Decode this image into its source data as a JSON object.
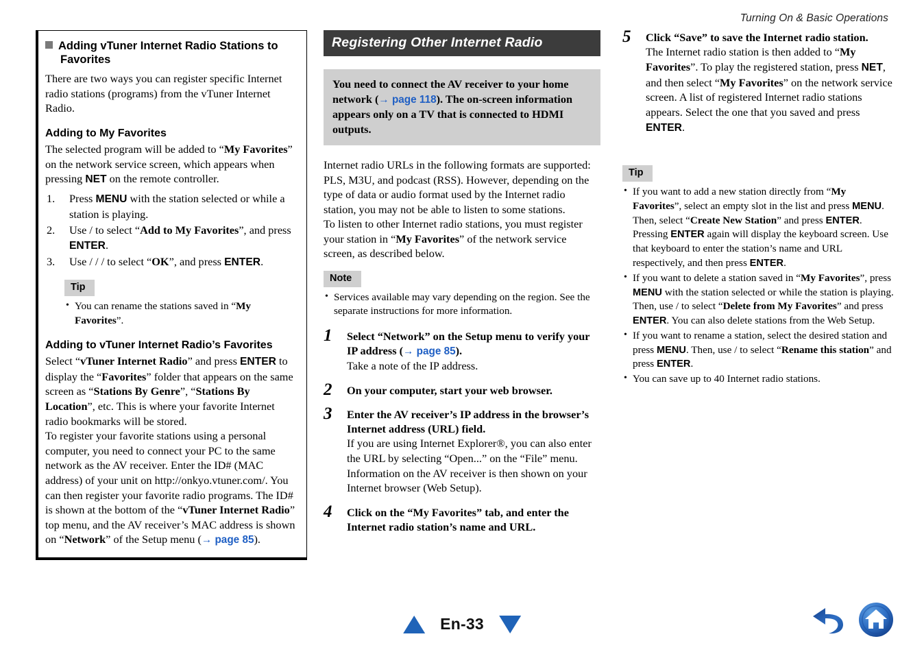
{
  "header": {
    "running_title": "Turning On & Basic Operations"
  },
  "column1": {
    "heading": "Adding vTuner Internet Radio Stations to Favorites",
    "intro": "There are two ways you can register specific Internet radio stations (programs) from the vTuner Internet Radio.",
    "sub1": {
      "heading": "Adding to My Favorites",
      "intro_a": "The selected program will be added to “",
      "intro_b": "My Favorites",
      "intro_c": "” on the network service screen, which appears when pressing ",
      "intro_d": "NET",
      "intro_e": " on the remote controller.",
      "steps": [
        {
          "number": "1.",
          "a": "Press ",
          "b": "MENU",
          "c": " with the station selected or while a station is playing."
        },
        {
          "number": "2.",
          "a": "Use   /   to select “",
          "b": "Add to My Favorites",
          "c": "”, and press ",
          "d": "ENTER",
          "e": "."
        },
        {
          "number": "3.",
          "a": "Use   /   /   /    to select “",
          "b": "OK",
          "c": "”, and press ",
          "d": "ENTER",
          "e": "."
        }
      ],
      "tip_badge": "Tip",
      "tip_a": "You can rename the stations saved in “",
      "tip_b": "My Favorites",
      "tip_c": "”."
    },
    "sub2": {
      "heading": "Adding to vTuner Internet Radio’s Favorites",
      "p1_a": "Select “",
      "p1_b": "vTuner Internet Radio",
      "p1_c": "” and press ",
      "p1_d": "ENTER",
      "p1_e": " to display the “",
      "p1_f": "Favorites",
      "p1_g": "” folder that appears on the same screen as “",
      "p1_h": "Stations By Genre",
      "p1_i": "”, “",
      "p1_j": "Stations By Location",
      "p1_k": "”, etc. This is where your favorite Internet radio bookmarks will be stored.",
      "p2_a": "To register your favorite stations using a personal computer, you need to connect your PC to the same network as the AV receiver. Enter the ID# (MAC address) of your unit on http://onkyo.vtuner.com/. You can then register your favorite radio programs. The ID# is shown at the bottom of the “",
      "p2_b": "vTuner Internet Radio",
      "p2_c": "” top menu, and the AV receiver’s MAC address is shown on “",
      "p2_d": "Network",
      "p2_e": "” of the Setup menu (",
      "p2_xref": "→ page 85",
      "p2_f": ")."
    }
  },
  "column2": {
    "banner": "Registering Other Internet Radio",
    "callout_a": "You need to connect the AV receiver to your home network (",
    "callout_xref": "→ page 118",
    "callout_b": "). The on-screen information appears only on a TV that is connected to HDMI outputs.",
    "p1": "Internet radio URLs in the following formats are supported: PLS, M3U, and podcast (RSS). However, depending on the type of data or audio format used by the Internet radio station, you may not be able to listen to some stations.",
    "p2_a": "To listen to other Internet radio stations, you must register your station in “",
    "p2_b": "My Favorites",
    "p2_c": "” of the network service screen, as described below.",
    "note_badge": "Note",
    "note_bullet": "Services available may vary depending on the region. See the separate instructions for more information.",
    "steps": [
      {
        "number": "1",
        "title_a": "Select “Network” on the Setup menu to verify your IP address (",
        "title_xref": "→ page 85",
        "title_b": ").",
        "desc": "Take a note of the IP address."
      },
      {
        "number": "2",
        "title_a": "On your computer, start your web browser.",
        "desc": ""
      },
      {
        "number": "3",
        "title_a": "Enter the AV receiver’s IP address in the browser’s Internet address (URL) field.",
        "desc": "If you are using Internet Explorer®, you can also enter the URL by selecting “Open...” on the “File” menu. Information on the AV receiver is then shown on your Internet browser (Web Setup)."
      },
      {
        "number": "4",
        "title_a": "Click on the “My Favorites” tab, and enter the Internet radio station’s name and URL.",
        "desc": ""
      }
    ]
  },
  "column3": {
    "step5": {
      "number": "5",
      "title": "Click “Save” to save the Internet radio station.",
      "d_a": "The Internet radio station is then added to “",
      "d_b": "My Favorites",
      "d_c": "”. To play the registered station, press ",
      "d_d": "NET",
      "d_e": ", and then select “",
      "d_f": "My Favorites",
      "d_g": "” on the network service screen. A list of registered Internet radio stations appears. Select the one that you saved and press ",
      "d_h": "ENTER",
      "d_i": "."
    },
    "tip_badge": "Tip",
    "tips": [
      {
        "a": "If you want to add a new station directly from “",
        "b": "My Favorites",
        "c": "”, select an empty slot in the list and press ",
        "d": "MENU",
        "e": ". Then, select “",
        "f": "Create New Station",
        "g": "” and press ",
        "h": "ENTER",
        "i": ". Pressing ",
        "j": "ENTER",
        "k": " again will display the keyboard screen. Use that keyboard to enter the station’s name and URL respectively, and then press ",
        "l": "ENTER",
        "m": "."
      },
      {
        "a": "If you want to delete a station saved in “",
        "b": "My Favorites",
        "c": "”, press ",
        "d": "MENU",
        "e": " with the station selected or while the station is playing. Then, use   /   to select “",
        "f": "Delete from My Favorites",
        "g": "” and press ",
        "h": "ENTER",
        "i": ". You can also delete stations from the Web Setup."
      },
      {
        "a": "If you want to rename a station, select the desired station and press ",
        "b": "MENU",
        "c": ". Then, use   /   to select “",
        "d": "Rename this station",
        "e": "” and press ",
        "f": "ENTER",
        "g": "."
      },
      {
        "a": "You can save up to 40 Internet radio stations."
      }
    ]
  },
  "footer": {
    "page_label": "En-33",
    "prev_icon": "triangle-up-icon",
    "next_icon": "triangle-down-icon",
    "back_icon": "back-arrow-icon",
    "home_icon": "home-icon",
    "accent_color": "#1f63b8"
  }
}
